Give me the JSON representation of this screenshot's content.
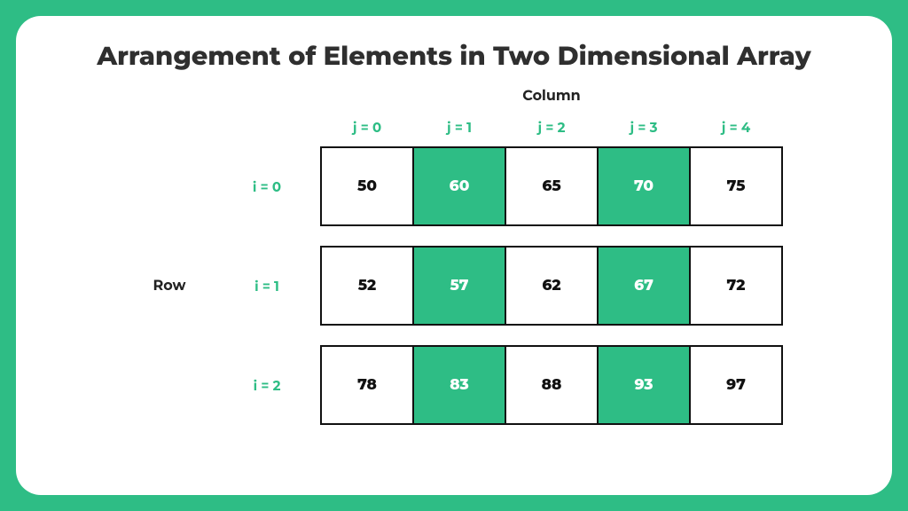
{
  "title": "Arrangement of Elements in Two Dimensional Array",
  "axis": {
    "column": "Column",
    "row": "Row"
  },
  "j_labels": [
    "j = 0",
    "j = 1",
    "j = 2",
    "j = 3",
    "j = 4"
  ],
  "i_labels": [
    "i = 0",
    "i = 1",
    "i = 2"
  ],
  "chart_data": {
    "type": "table",
    "rows": 3,
    "cols": 5,
    "highlight_cols": [
      1,
      3
    ],
    "values": [
      [
        50,
        60,
        65,
        70,
        75
      ],
      [
        52,
        57,
        62,
        67,
        72
      ],
      [
        78,
        83,
        88,
        93,
        97
      ]
    ]
  },
  "colors": {
    "accent": "#2ebd85"
  }
}
